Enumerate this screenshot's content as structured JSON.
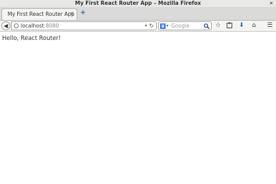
{
  "window": {
    "title": "My First React Router App – Mozilla Firefox"
  },
  "tabs": [
    {
      "label": "My First React Router App"
    }
  ],
  "urlbar": {
    "host": "localhost",
    "port": ":8080"
  },
  "search": {
    "engine": "Google",
    "placeholder": "Google"
  },
  "toolbar_icons": [
    "bookmark-star-icon",
    "reading-list-icon",
    "downloads-icon",
    "home-icon",
    "menu-icon"
  ],
  "page": {
    "text": "Hello, React Router!"
  },
  "colors": {
    "accent": "#2a6db0",
    "chrome": "#e8e8e7",
    "text": "#333333"
  }
}
